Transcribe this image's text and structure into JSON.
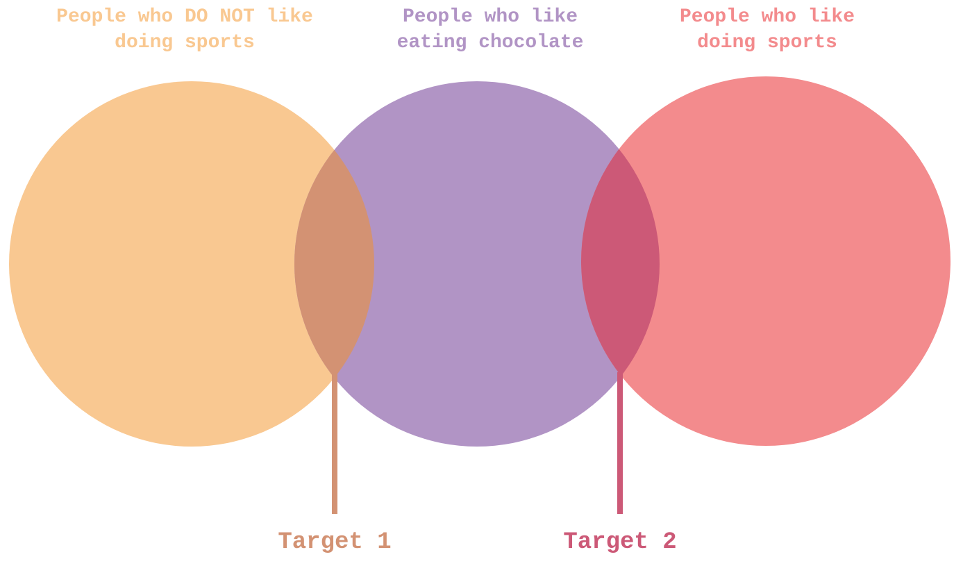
{
  "colors": {
    "background": "#ffffff",
    "left_set": "#f9c891",
    "middle_set": "#b194c5",
    "right_set": "#f38b8d",
    "left_middle_overlap": "#d39273",
    "middle_right_overlap": "#cc5977"
  },
  "sets": [
    {
      "id": "left",
      "label_lines": [
        "People who DO NOT like",
        "doing sports"
      ],
      "color": "#f9c891"
    },
    {
      "id": "middle",
      "label_lines": [
        "People who like",
        "eating chocolate"
      ],
      "color": "#b194c5"
    },
    {
      "id": "right",
      "label_lines": [
        "People who like",
        "doing sports"
      ],
      "color": "#f38b8d"
    }
  ],
  "targets": [
    {
      "label": "Target 1",
      "color": "#d39273"
    },
    {
      "label": "Target 2",
      "color": "#cc5977"
    }
  ]
}
